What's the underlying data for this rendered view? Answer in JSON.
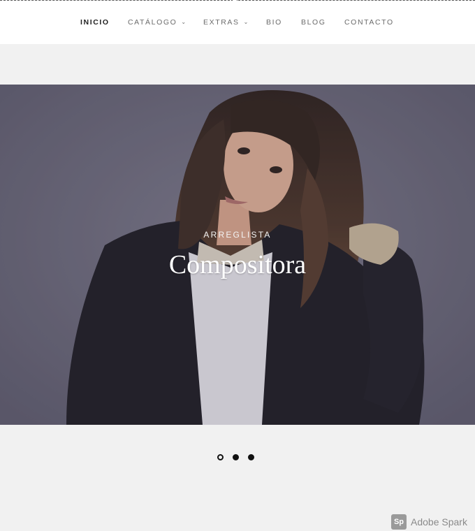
{
  "nav": {
    "items": [
      {
        "label": "INICIO",
        "active": true
      },
      {
        "label": "CATÁLOGO",
        "dropdown": true
      },
      {
        "label": "EXTRAS",
        "dropdown": true
      },
      {
        "label": "BIO"
      },
      {
        "label": "BLOG"
      },
      {
        "label": "CONTACTO"
      }
    ]
  },
  "hero": {
    "eyebrow": "ARREGLISTA",
    "headline": "Compositora"
  },
  "slider": {
    "count": 3,
    "active_index": 0
  },
  "badge": {
    "logo": "Sp",
    "text": "Adobe Spark"
  },
  "colors": {
    "hero_bg": "#6b6977",
    "page_bg": "#f1f1f1"
  }
}
